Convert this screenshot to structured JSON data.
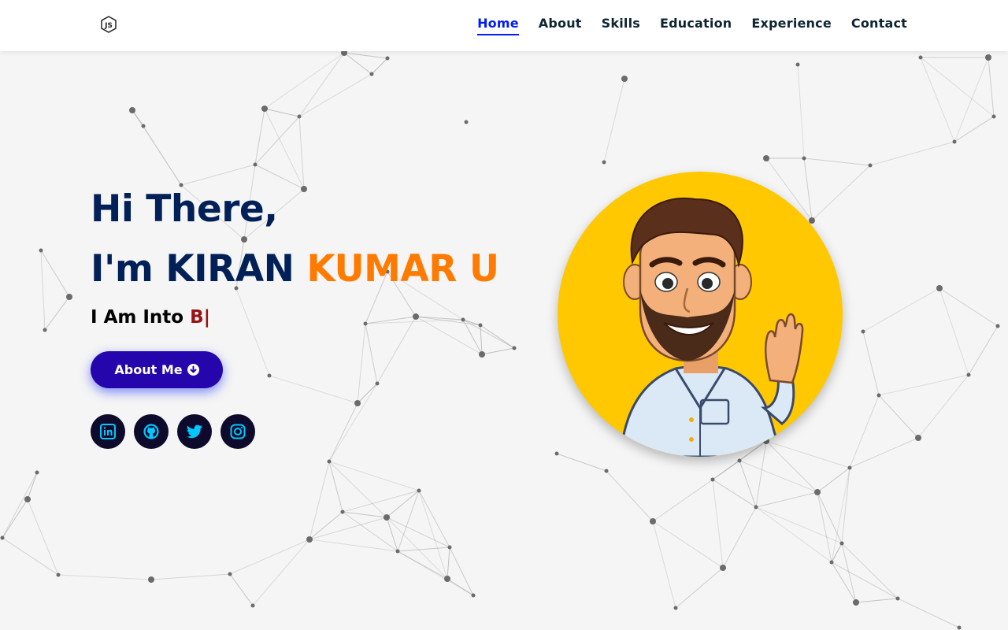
{
  "nav": {
    "logo_icon": "js-hexagon-icon",
    "items": [
      {
        "label": "Home",
        "active": true
      },
      {
        "label": "About",
        "active": false
      },
      {
        "label": "Skills",
        "active": false
      },
      {
        "label": "Education",
        "active": false
      },
      {
        "label": "Experience",
        "active": false
      },
      {
        "label": "Contact",
        "active": false
      }
    ]
  },
  "hero": {
    "greeting": "Hi There,",
    "intro_prefix": "I'm KIRAN ",
    "intro_accent": "KUMAR U",
    "typing_prefix": "I Am Into ",
    "typing_value": "B",
    "typing_cursor": "|",
    "button_label": "About Me",
    "button_icon": "arrow-circle-down-icon"
  },
  "socials": [
    {
      "name": "linkedin",
      "icon": "linkedin-icon"
    },
    {
      "name": "github",
      "icon": "github-icon"
    },
    {
      "name": "twitter",
      "icon": "twitter-icon"
    },
    {
      "name": "instagram",
      "icon": "instagram-icon"
    }
  ],
  "avatar": {
    "icon": "bitmoji-avatar-icon"
  },
  "colors": {
    "primary_text": "#002057",
    "accent_orange": "#ff7b00",
    "active_nav": "#011aff",
    "typing_color": "#991314",
    "button_bg": "#2506ad",
    "social_bg": "#0e0a2b",
    "social_icon": "#00c8ff",
    "avatar_bg": "#ffc800"
  }
}
